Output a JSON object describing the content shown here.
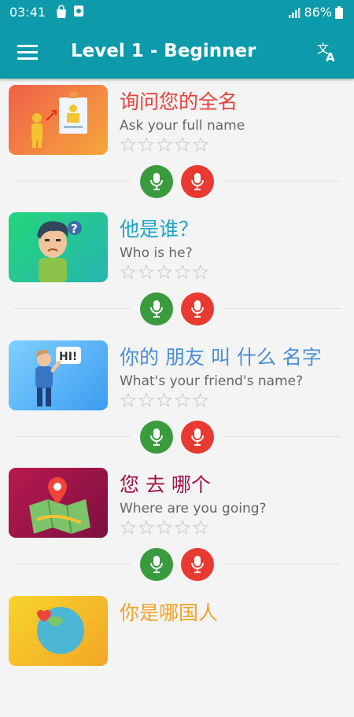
{
  "status": {
    "time": "03:41",
    "battery": "86%"
  },
  "app_bar": {
    "title": "Level 1 - Beginner"
  },
  "lessons": [
    {
      "chinese": "询问您的全名",
      "english": "Ask your full name",
      "color": "#e8403a",
      "stars": 0
    },
    {
      "chinese": "他是谁？",
      "english": "Who is he?",
      "color": "#1fa5c7",
      "stars": 0
    },
    {
      "chinese": "你的 朋友 叫 什么 名字",
      "english": "What's your friend's name?",
      "color": "#4a8fd6",
      "stars": 0
    },
    {
      "chinese": "您 去 哪个",
      "english": "Where are you going?",
      "color": "#a3124a",
      "stars": 0
    },
    {
      "chinese": "你是哪国人",
      "english": "",
      "color": "#f1a32a",
      "stars": 0
    }
  ],
  "colors": {
    "primary": "#0d9bab",
    "play": "#3a9a3e",
    "record": "#e83a30"
  },
  "icons": {
    "menu": "hamburger-menu-icon",
    "translate": "translate-icon",
    "play": "microphone-icon",
    "record": "microphone-icon"
  }
}
